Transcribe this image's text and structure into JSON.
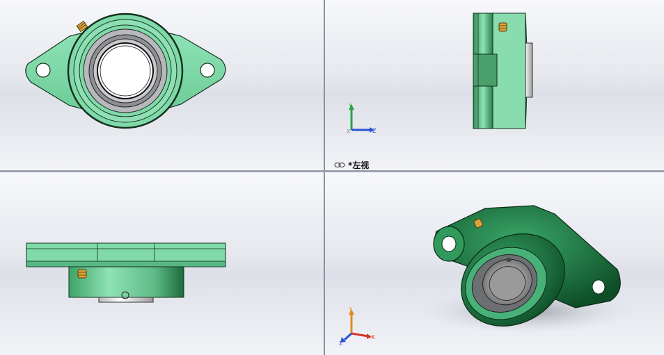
{
  "views": {
    "front": {
      "name": "front-view"
    },
    "left": {
      "name": "left-view",
      "label": "*左视"
    },
    "top": {
      "name": "top-view"
    },
    "iso": {
      "name": "isometric-view"
    }
  },
  "triad": {
    "left_view": {
      "y": "Y",
      "x": "X",
      "z": "Z"
    },
    "iso_view": {
      "y": "Y",
      "x": "X",
      "z": "Z"
    }
  },
  "colors": {
    "body_green": "#7fd9a8",
    "dark_green": "#1f6a3c",
    "bearing_gray": "#a9aaad",
    "grease_fitting": "#d9a43a",
    "axis_y": "#2aa24a",
    "axis_z": "#2a52d2",
    "axis_x_iso": "#d2332a",
    "axis_y_iso": "#e08a20"
  }
}
